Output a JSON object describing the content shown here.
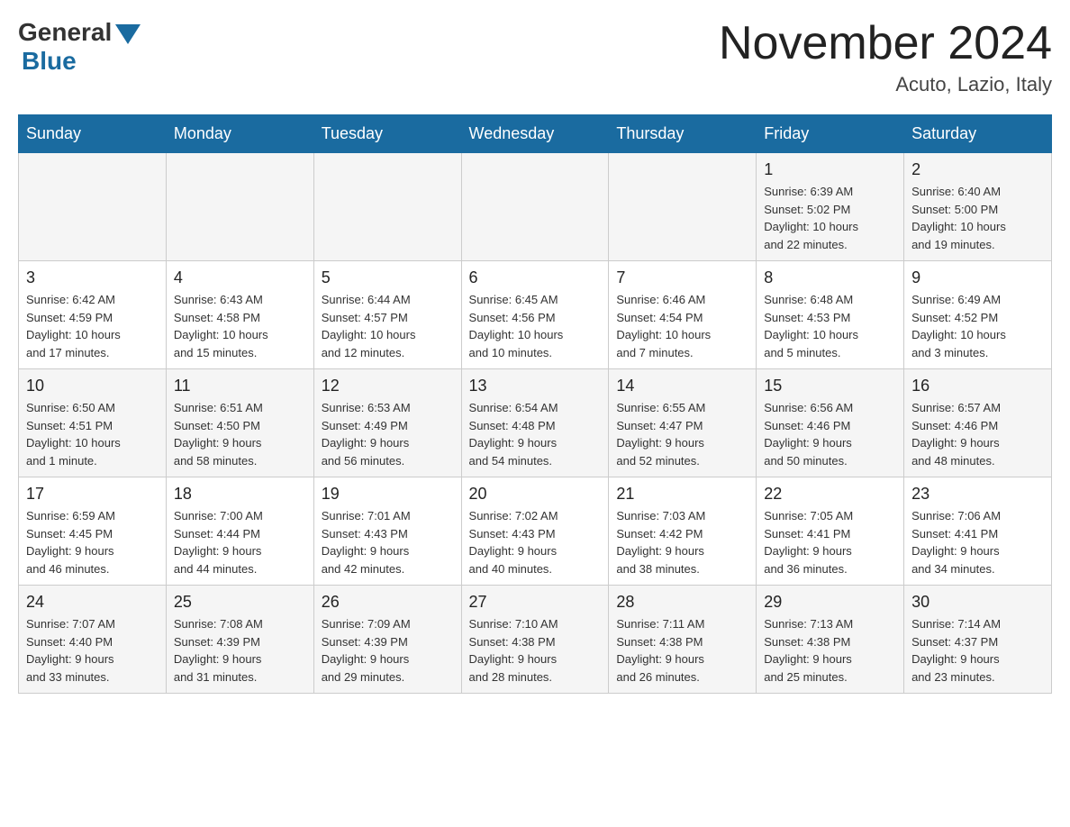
{
  "header": {
    "logo_general": "General",
    "logo_blue": "Blue",
    "month_title": "November 2024",
    "location": "Acuto, Lazio, Italy"
  },
  "weekdays": [
    "Sunday",
    "Monday",
    "Tuesday",
    "Wednesday",
    "Thursday",
    "Friday",
    "Saturday"
  ],
  "weeks": [
    [
      {
        "day": "",
        "info": ""
      },
      {
        "day": "",
        "info": ""
      },
      {
        "day": "",
        "info": ""
      },
      {
        "day": "",
        "info": ""
      },
      {
        "day": "",
        "info": ""
      },
      {
        "day": "1",
        "info": "Sunrise: 6:39 AM\nSunset: 5:02 PM\nDaylight: 10 hours\nand 22 minutes."
      },
      {
        "day": "2",
        "info": "Sunrise: 6:40 AM\nSunset: 5:00 PM\nDaylight: 10 hours\nand 19 minutes."
      }
    ],
    [
      {
        "day": "3",
        "info": "Sunrise: 6:42 AM\nSunset: 4:59 PM\nDaylight: 10 hours\nand 17 minutes."
      },
      {
        "day": "4",
        "info": "Sunrise: 6:43 AM\nSunset: 4:58 PM\nDaylight: 10 hours\nand 15 minutes."
      },
      {
        "day": "5",
        "info": "Sunrise: 6:44 AM\nSunset: 4:57 PM\nDaylight: 10 hours\nand 12 minutes."
      },
      {
        "day": "6",
        "info": "Sunrise: 6:45 AM\nSunset: 4:56 PM\nDaylight: 10 hours\nand 10 minutes."
      },
      {
        "day": "7",
        "info": "Sunrise: 6:46 AM\nSunset: 4:54 PM\nDaylight: 10 hours\nand 7 minutes."
      },
      {
        "day": "8",
        "info": "Sunrise: 6:48 AM\nSunset: 4:53 PM\nDaylight: 10 hours\nand 5 minutes."
      },
      {
        "day": "9",
        "info": "Sunrise: 6:49 AM\nSunset: 4:52 PM\nDaylight: 10 hours\nand 3 minutes."
      }
    ],
    [
      {
        "day": "10",
        "info": "Sunrise: 6:50 AM\nSunset: 4:51 PM\nDaylight: 10 hours\nand 1 minute."
      },
      {
        "day": "11",
        "info": "Sunrise: 6:51 AM\nSunset: 4:50 PM\nDaylight: 9 hours\nand 58 minutes."
      },
      {
        "day": "12",
        "info": "Sunrise: 6:53 AM\nSunset: 4:49 PM\nDaylight: 9 hours\nand 56 minutes."
      },
      {
        "day": "13",
        "info": "Sunrise: 6:54 AM\nSunset: 4:48 PM\nDaylight: 9 hours\nand 54 minutes."
      },
      {
        "day": "14",
        "info": "Sunrise: 6:55 AM\nSunset: 4:47 PM\nDaylight: 9 hours\nand 52 minutes."
      },
      {
        "day": "15",
        "info": "Sunrise: 6:56 AM\nSunset: 4:46 PM\nDaylight: 9 hours\nand 50 minutes."
      },
      {
        "day": "16",
        "info": "Sunrise: 6:57 AM\nSunset: 4:46 PM\nDaylight: 9 hours\nand 48 minutes."
      }
    ],
    [
      {
        "day": "17",
        "info": "Sunrise: 6:59 AM\nSunset: 4:45 PM\nDaylight: 9 hours\nand 46 minutes."
      },
      {
        "day": "18",
        "info": "Sunrise: 7:00 AM\nSunset: 4:44 PM\nDaylight: 9 hours\nand 44 minutes."
      },
      {
        "day": "19",
        "info": "Sunrise: 7:01 AM\nSunset: 4:43 PM\nDaylight: 9 hours\nand 42 minutes."
      },
      {
        "day": "20",
        "info": "Sunrise: 7:02 AM\nSunset: 4:43 PM\nDaylight: 9 hours\nand 40 minutes."
      },
      {
        "day": "21",
        "info": "Sunrise: 7:03 AM\nSunset: 4:42 PM\nDaylight: 9 hours\nand 38 minutes."
      },
      {
        "day": "22",
        "info": "Sunrise: 7:05 AM\nSunset: 4:41 PM\nDaylight: 9 hours\nand 36 minutes."
      },
      {
        "day": "23",
        "info": "Sunrise: 7:06 AM\nSunset: 4:41 PM\nDaylight: 9 hours\nand 34 minutes."
      }
    ],
    [
      {
        "day": "24",
        "info": "Sunrise: 7:07 AM\nSunset: 4:40 PM\nDaylight: 9 hours\nand 33 minutes."
      },
      {
        "day": "25",
        "info": "Sunrise: 7:08 AM\nSunset: 4:39 PM\nDaylight: 9 hours\nand 31 minutes."
      },
      {
        "day": "26",
        "info": "Sunrise: 7:09 AM\nSunset: 4:39 PM\nDaylight: 9 hours\nand 29 minutes."
      },
      {
        "day": "27",
        "info": "Sunrise: 7:10 AM\nSunset: 4:38 PM\nDaylight: 9 hours\nand 28 minutes."
      },
      {
        "day": "28",
        "info": "Sunrise: 7:11 AM\nSunset: 4:38 PM\nDaylight: 9 hours\nand 26 minutes."
      },
      {
        "day": "29",
        "info": "Sunrise: 7:13 AM\nSunset: 4:38 PM\nDaylight: 9 hours\nand 25 minutes."
      },
      {
        "day": "30",
        "info": "Sunrise: 7:14 AM\nSunset: 4:37 PM\nDaylight: 9 hours\nand 23 minutes."
      }
    ]
  ],
  "colors": {
    "header_bg": "#1a6ba0",
    "accent_blue": "#1a6ba0"
  }
}
